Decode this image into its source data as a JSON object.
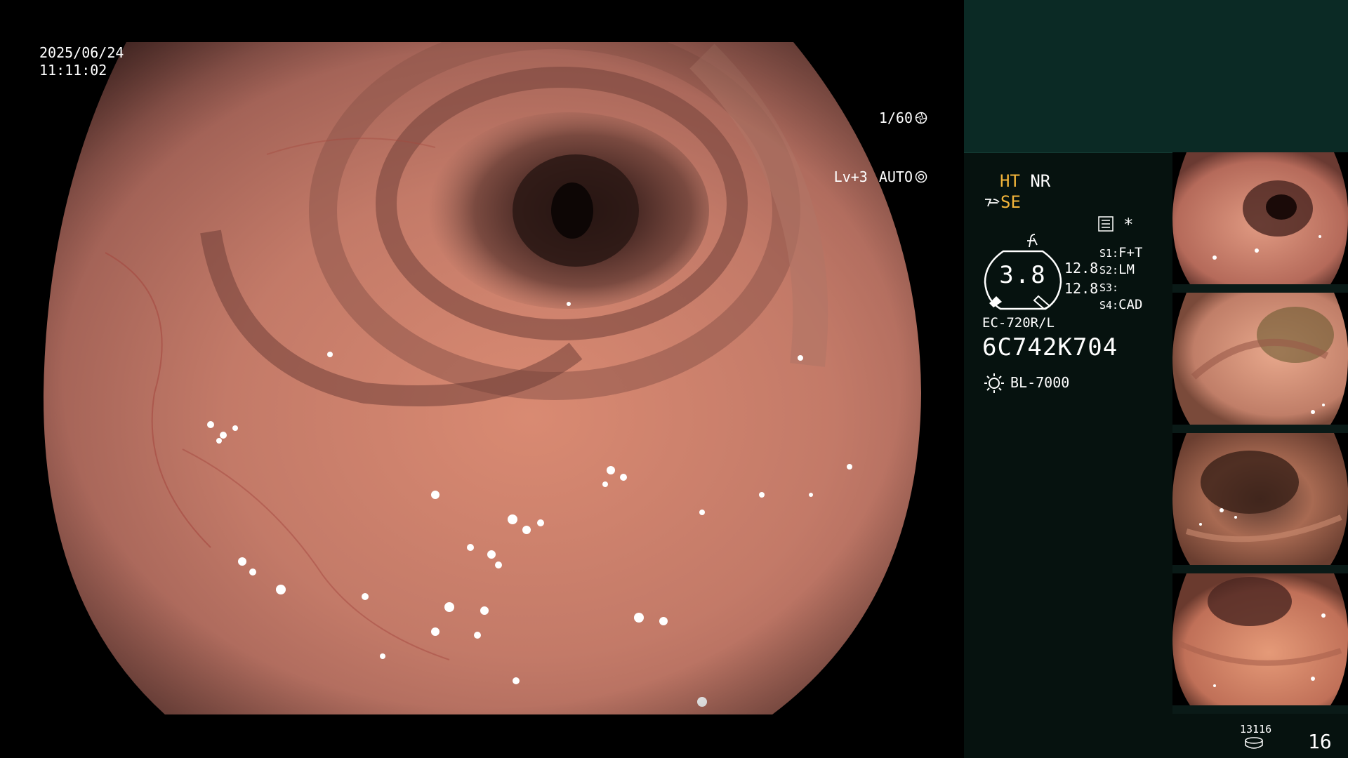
{
  "osd": {
    "date": "2025/06/24",
    "time": "11:11:02",
    "shutter": "1/60",
    "level": "Lv+3",
    "mode": "AUTO"
  },
  "panel": {
    "ht": "HT",
    "nr": "NR",
    "se": "SE",
    "gauge_value": "3.8",
    "value_a": "12.8",
    "value_b": "12.8",
    "s1_label": "S1:",
    "s1_value": "F+T",
    "s2_label": "S2:",
    "s2_value": "LM",
    "s3_label": "S3:",
    "s3_value": "",
    "s4_label": "S4:",
    "s4_value": "CAD",
    "star": "*",
    "scope_model": "EC-720R/L",
    "scope_serial": "6C742K704",
    "light_source": "BL-7000",
    "counter": "13116",
    "frame_count": "16"
  },
  "colors": {
    "amber": "#f2b43a",
    "panel_bg": "#06120f",
    "panel_top": "#0b2a25"
  }
}
